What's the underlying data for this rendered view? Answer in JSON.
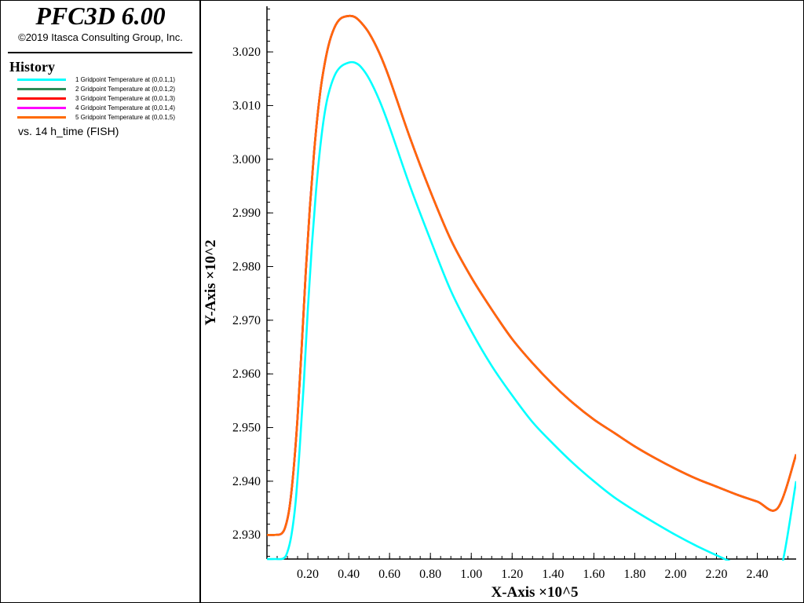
{
  "app": {
    "title": "PFC3D 6.00",
    "copyright": "©2019 Itasca Consulting Group, Inc."
  },
  "legend": {
    "heading": "History",
    "vs_label": "vs. 14 h_time (FISH)",
    "items": [
      {
        "label": "1 Gridpoint Temperature at (0,0.1,1)",
        "color": "#00ffff"
      },
      {
        "label": "2 Gridpoint Temperature at (0,0.1,2)",
        "color": "#2e8b57"
      },
      {
        "label": "3 Gridpoint Temperature at (0,0.1,3)",
        "color": "#ff0000"
      },
      {
        "label": "4 Gridpoint Temperature at (0,0.1,4)",
        "color": "#ff00ff"
      },
      {
        "label": "5 Gridpoint Temperature at (0,0.1,5)",
        "color": "#ff6a00"
      }
    ]
  },
  "chart_data": {
    "type": "line",
    "title": "",
    "xlabel": "X-Axis ×10^5",
    "ylabel": "Y-Axis ×10^2",
    "xlim": [
      0.0,
      2.59
    ],
    "ylim": [
      2.9255,
      3.0285
    ],
    "x_ticks": [
      "0.20",
      "0.40",
      "0.60",
      "0.80",
      "1.00",
      "1.20",
      "1.40",
      "1.60",
      "1.80",
      "2.00",
      "2.20",
      "2.40"
    ],
    "y_ticks": [
      "2.930",
      "2.940",
      "2.950",
      "2.960",
      "2.970",
      "2.980",
      "2.990",
      "3.000",
      "3.010",
      "3.020"
    ],
    "grid": false,
    "legend_position": "left-panel",
    "series": [
      {
        "name": "1 Gridpoint Temperature at (0,0.1,1)",
        "color": "#00ffff",
        "x": [
          0.0,
          0.04,
          0.08,
          0.1,
          0.12,
          0.14,
          0.16,
          0.18,
          0.2,
          0.22,
          0.24,
          0.26,
          0.28,
          0.3,
          0.33,
          0.36,
          0.4,
          0.43,
          0.46,
          0.5,
          0.55,
          0.6,
          0.7,
          0.8,
          0.9,
          1.0,
          1.1,
          1.2,
          1.3,
          1.4,
          1.5,
          1.6,
          1.7,
          1.8,
          1.9,
          2.0,
          2.1,
          2.2,
          2.3,
          2.4,
          2.5,
          2.59
        ],
        "y": [
          2.9255,
          2.9255,
          2.9256,
          2.9268,
          2.93,
          2.936,
          2.946,
          2.958,
          2.972,
          2.984,
          2.994,
          3.002,
          3.008,
          3.012,
          3.0155,
          3.0172,
          3.018,
          3.018,
          3.0172,
          3.015,
          3.011,
          3.006,
          2.995,
          2.985,
          2.9755,
          2.968,
          2.9615,
          2.956,
          2.951,
          2.947,
          2.9433,
          2.94,
          2.937,
          2.9345,
          2.9322,
          2.93,
          2.928,
          2.9262,
          2.9245,
          2.923,
          2.9215,
          2.94
        ]
      },
      {
        "name": "2 Gridpoint Temperature at (0,0.1,2)",
        "color": "#2e8b57",
        "x": [
          0.0,
          0.04,
          0.07,
          0.09,
          0.11,
          0.13,
          0.15,
          0.17,
          0.19,
          0.21,
          0.23,
          0.25,
          0.27,
          0.3,
          0.33,
          0.36,
          0.4,
          0.43,
          0.46,
          0.5,
          0.55,
          0.6,
          0.7,
          0.8,
          0.9,
          1.0,
          1.1,
          1.2,
          1.3,
          1.4,
          1.5,
          1.6,
          1.7,
          1.8,
          1.9,
          2.0,
          2.1,
          2.2,
          2.3,
          2.4,
          2.5,
          2.59
        ],
        "y": [
          2.93,
          2.93,
          2.9302,
          2.9315,
          2.935,
          2.942,
          2.952,
          2.965,
          2.979,
          2.991,
          3.001,
          3.009,
          3.015,
          3.021,
          3.0245,
          3.0262,
          3.0267,
          3.0265,
          3.0255,
          3.0235,
          3.0198,
          3.015,
          3.004,
          2.994,
          2.985,
          2.978,
          2.972,
          2.9665,
          2.962,
          2.958,
          2.9545,
          2.9515,
          2.949,
          2.9465,
          2.9443,
          2.9423,
          2.9405,
          2.939,
          2.9375,
          2.9362,
          2.935,
          2.945
        ]
      },
      {
        "name": "3 Gridpoint Temperature at (0,0.1,3)",
        "color": "#ff0000",
        "x": [
          0.0,
          0.04,
          0.07,
          0.09,
          0.11,
          0.13,
          0.15,
          0.17,
          0.19,
          0.21,
          0.23,
          0.25,
          0.27,
          0.3,
          0.33,
          0.36,
          0.4,
          0.43,
          0.46,
          0.5,
          0.55,
          0.6,
          0.7,
          0.8,
          0.9,
          1.0,
          1.1,
          1.2,
          1.3,
          1.4,
          1.5,
          1.6,
          1.7,
          1.8,
          1.9,
          2.0,
          2.1,
          2.2,
          2.3,
          2.4,
          2.5,
          2.59
        ],
        "y": [
          2.93,
          2.93,
          2.9302,
          2.9315,
          2.935,
          2.942,
          2.952,
          2.965,
          2.979,
          2.991,
          3.001,
          3.009,
          3.015,
          3.021,
          3.0245,
          3.0262,
          3.0267,
          3.0265,
          3.0255,
          3.0235,
          3.0198,
          3.015,
          3.004,
          2.994,
          2.985,
          2.978,
          2.972,
          2.9665,
          2.962,
          2.958,
          2.9545,
          2.9515,
          2.949,
          2.9465,
          2.9443,
          2.9423,
          2.9405,
          2.939,
          2.9375,
          2.9362,
          2.935,
          2.945
        ]
      },
      {
        "name": "4 Gridpoint Temperature at (0,0.1,4)",
        "color": "#ff00ff",
        "x": [
          0.0,
          0.04,
          0.07,
          0.09,
          0.11,
          0.13,
          0.15,
          0.17,
          0.19,
          0.21,
          0.23,
          0.25,
          0.27,
          0.3,
          0.33,
          0.36,
          0.4,
          0.43,
          0.46,
          0.5,
          0.55,
          0.6,
          0.7,
          0.8,
          0.9,
          1.0,
          1.1,
          1.2,
          1.3,
          1.4,
          1.5,
          1.6,
          1.7,
          1.8,
          1.9,
          2.0,
          2.1,
          2.2,
          2.3,
          2.4,
          2.5,
          2.59
        ],
        "y": [
          2.93,
          2.93,
          2.9302,
          2.9315,
          2.935,
          2.942,
          2.952,
          2.965,
          2.979,
          2.991,
          3.001,
          3.009,
          3.015,
          3.021,
          3.0245,
          3.0262,
          3.0267,
          3.0265,
          3.0255,
          3.0235,
          3.0198,
          3.015,
          3.004,
          2.994,
          2.985,
          2.978,
          2.972,
          2.9665,
          2.962,
          2.958,
          2.9545,
          2.9515,
          2.949,
          2.9465,
          2.9443,
          2.9423,
          2.9405,
          2.939,
          2.9375,
          2.9362,
          2.935,
          2.945
        ]
      },
      {
        "name": "5 Gridpoint Temperature at (0,0.1,5)",
        "color": "#ff6a00",
        "x": [
          0.0,
          0.04,
          0.07,
          0.09,
          0.11,
          0.13,
          0.15,
          0.17,
          0.19,
          0.21,
          0.23,
          0.25,
          0.27,
          0.3,
          0.33,
          0.36,
          0.4,
          0.43,
          0.46,
          0.5,
          0.55,
          0.6,
          0.7,
          0.8,
          0.9,
          1.0,
          1.1,
          1.2,
          1.3,
          1.4,
          1.5,
          1.6,
          1.7,
          1.8,
          1.9,
          2.0,
          2.1,
          2.2,
          2.3,
          2.4,
          2.5,
          2.59
        ],
        "y": [
          2.93,
          2.93,
          2.9302,
          2.9315,
          2.935,
          2.942,
          2.952,
          2.965,
          2.979,
          2.991,
          3.001,
          3.009,
          3.015,
          3.021,
          3.0245,
          3.0262,
          3.0267,
          3.0265,
          3.0255,
          3.0235,
          3.0198,
          3.015,
          3.004,
          2.994,
          2.985,
          2.978,
          2.972,
          2.9665,
          2.962,
          2.958,
          2.9545,
          2.9515,
          2.949,
          2.9465,
          2.9443,
          2.9423,
          2.9405,
          2.939,
          2.9375,
          2.9362,
          2.935,
          2.945
        ]
      }
    ]
  }
}
